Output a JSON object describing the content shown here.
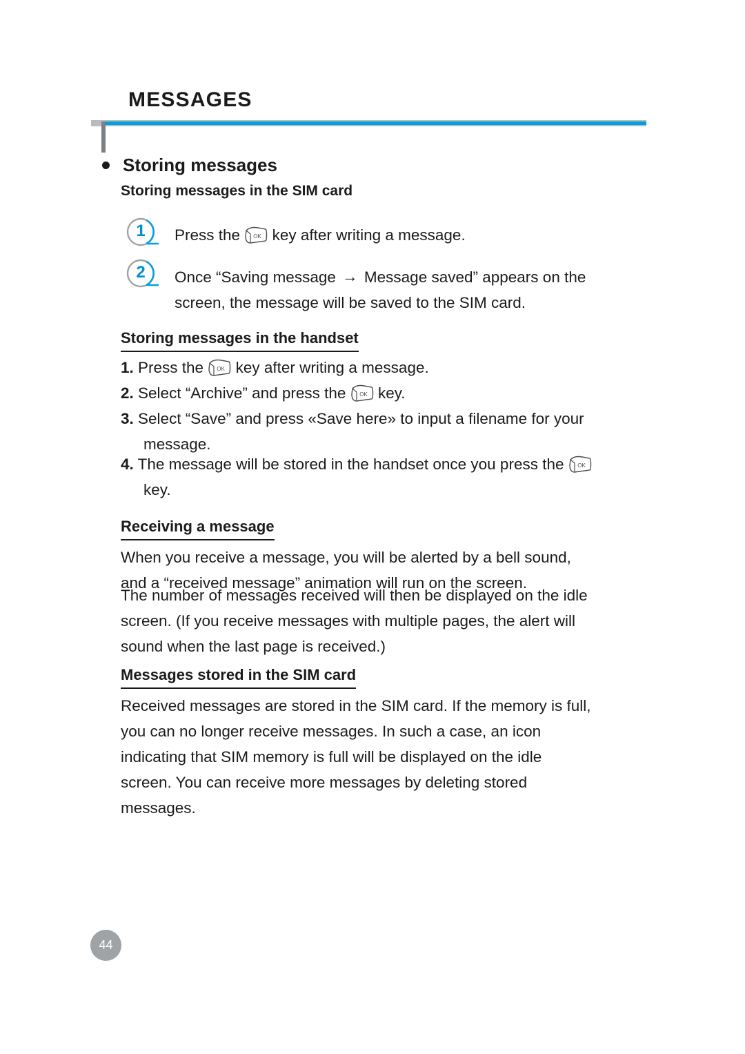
{
  "document": {
    "chapter_title": "MESSAGES",
    "page_number": "44",
    "accent_color": "#00a0e2",
    "rule_color": "#b9bcbe",
    "text_color": "#1b1b1b"
  },
  "section": {
    "heading": "Storing messages",
    "sim_subheading": "Storing messages in the SIM card",
    "steps": [
      {
        "number": "1",
        "text_before": "Press the",
        "icon": "ok-key-icon",
        "text_after": "key after writing a message."
      },
      {
        "number": "2",
        "text_line1_a": "Once “Saving message",
        "arrow": "→",
        "text_line1_b": "Message saved” appears on the",
        "text_line2": "screen, the message will be saved to the SIM card."
      }
    ]
  },
  "handset": {
    "heading": "Storing messages in the handset",
    "items": [
      {
        "marker": "1.",
        "text_before": "Press the",
        "icon": "ok-key-icon",
        "text_after": "key after writing a message."
      },
      {
        "marker": "2.",
        "text_before": "Select “Archive” and press the",
        "icon": "ok-key-icon",
        "text_after": "key."
      },
      {
        "marker": "3.",
        "line1": "Select “Save” and press «Save here» to input a filename for your",
        "line2": "message."
      },
      {
        "marker": "4.",
        "text_before": "The message will be stored in the handset once you press the",
        "icon": "ok-key-icon",
        "text_after": "key."
      }
    ]
  },
  "receiving": {
    "heading": "Receiving a message",
    "paragraph1_line1": "When you receive a message, you will be alerted by a bell sound,",
    "paragraph1_line2": "and a “received message” animation will run on the screen.",
    "paragraph2_line1": "The number of messages received will then be displayed on the idle",
    "paragraph2_line2": "screen. (If you receive messages with multiple pages, the alert will",
    "paragraph2_line3": "sound when the last page is received.)"
  },
  "stored_sim": {
    "heading": "Messages stored in the SIM card",
    "paragraph_line1": "Received messages are stored in the SIM card. If the memory is full,",
    "paragraph_line2": "you can no longer receive messages. In such a case, an icon",
    "paragraph_line3": "indicating that SIM memory is full will be displayed on the idle",
    "paragraph_line4": "screen. You can receive more messages by deleting stored",
    "paragraph_line5": "messages."
  },
  "icons": {
    "ok_key_label": "OK"
  }
}
